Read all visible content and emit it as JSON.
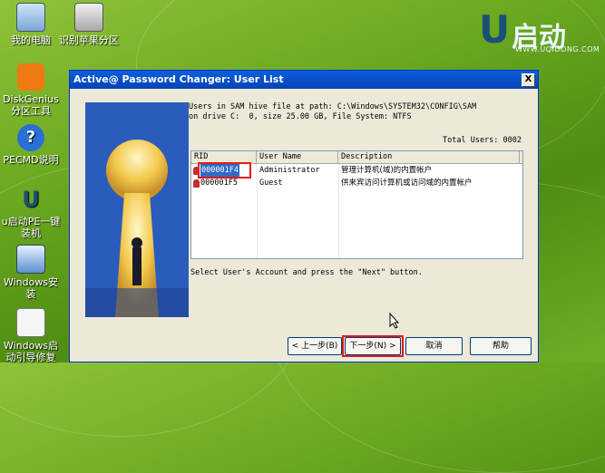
{
  "desktop": {
    "icons": [
      {
        "label": "我的电脑"
      },
      {
        "label": "识别苹果分区"
      },
      {
        "label": "DiskGenius分区工具"
      },
      {
        "label": "PECMD说明"
      },
      {
        "label": "u启动PE一键装机"
      },
      {
        "label": "Windows安装"
      },
      {
        "label": "Windows启动引导修复"
      }
    ],
    "logo": {
      "cn": "启动",
      "url": "WWW.UQIDONG.COM"
    }
  },
  "window": {
    "title": "Active@ Password Changer: User List",
    "close_label": "X",
    "info_line1": "Users in SAM hive file at path: C:\\Windows\\SYSTEM32\\CONFIG\\SAM",
    "info_line2": "on drive C:  0, size 25.00 GB, File System: NTFS",
    "total_users": "Total Users: 0002",
    "columns": [
      "RID",
      "User Name",
      "Description"
    ],
    "rows": [
      {
        "rid": "000001F4",
        "name": "Administrator",
        "desc": "管理计算机(域)的内置帐户"
      },
      {
        "rid": "000001F5",
        "name": "Guest",
        "desc": "供来宾访问计算机或访问域的内置帐户"
      }
    ],
    "select_message": "Select User's Account and press the \"Next\" button.",
    "buttons": {
      "back": "< 上一步(B)",
      "next": "下一步(N) >",
      "cancel": "取消",
      "help": "帮助"
    }
  }
}
